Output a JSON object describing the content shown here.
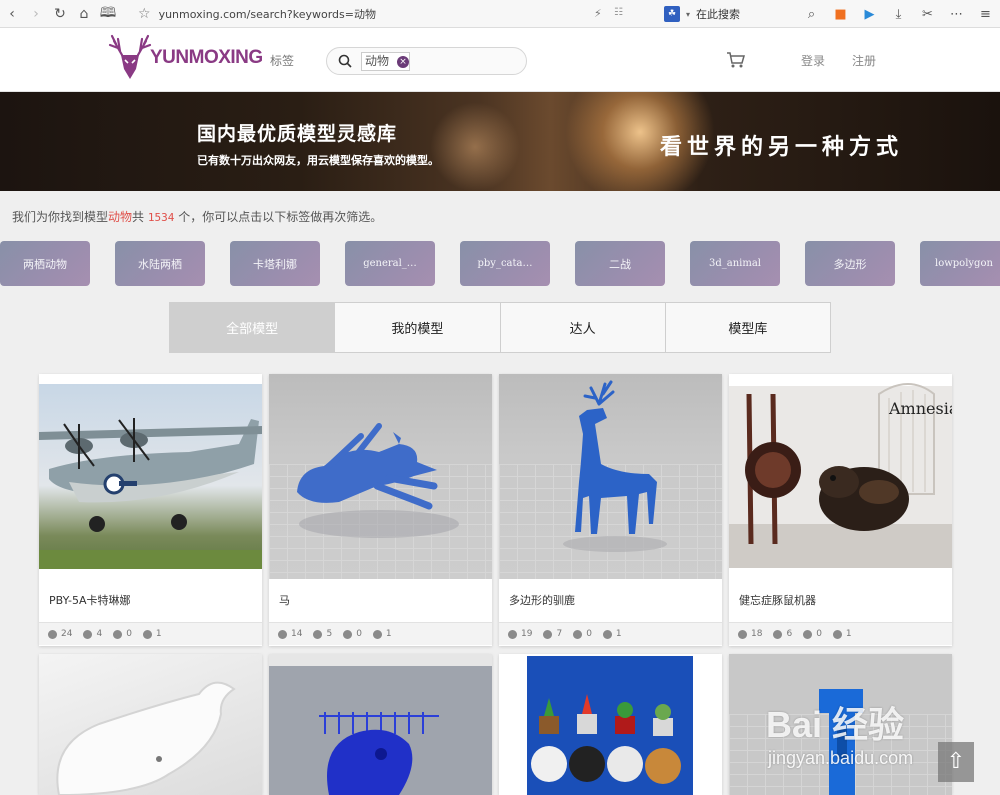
{
  "browser": {
    "url": "yunmoxing.com/search?keywords=动物",
    "search_engine_label": "在此搜索"
  },
  "site": {
    "logo_text": "YUNMOXING",
    "nav_tags": "标签",
    "search_keyword": "动物",
    "login": "登录",
    "register": "注册"
  },
  "banner": {
    "title": "国内最优质模型灵感库",
    "subtitle": "已有数十万出众网友，用云模型保存喜欢的模型。",
    "slogan": "看世界的另一种方式"
  },
  "result": {
    "prefix": "我们为你找到模型",
    "keyword": "动物",
    "middle": "共",
    "count": "1534",
    "suffix": "个，你可以点击以下标签做再次筛选。"
  },
  "chips": [
    "两栖动物",
    "水陆两栖",
    "卡塔利娜",
    "general_…",
    "pby_cata…",
    "二战",
    "3d_animal",
    "多边形",
    "lowpolygon"
  ],
  "tabs": [
    "全部模型",
    "我的模型",
    "达人",
    "模型库"
  ],
  "cards": [
    {
      "title": "PBY-5A卡特琳娜",
      "views": "24",
      "likes": "4",
      "downloads": "0",
      "comments": "1"
    },
    {
      "title": "马",
      "views": "14",
      "likes": "5",
      "downloads": "0",
      "comments": "1"
    },
    {
      "title": "多边形的驯鹿",
      "views": "19",
      "likes": "7",
      "downloads": "0",
      "comments": "1"
    },
    {
      "title": "健忘症豚鼠机器",
      "views": "18",
      "likes": "6",
      "downloads": "0",
      "comments": "1"
    }
  ],
  "watermark": {
    "brand": "Bai 经验",
    "domain": "jingyan.baidu.com"
  }
}
